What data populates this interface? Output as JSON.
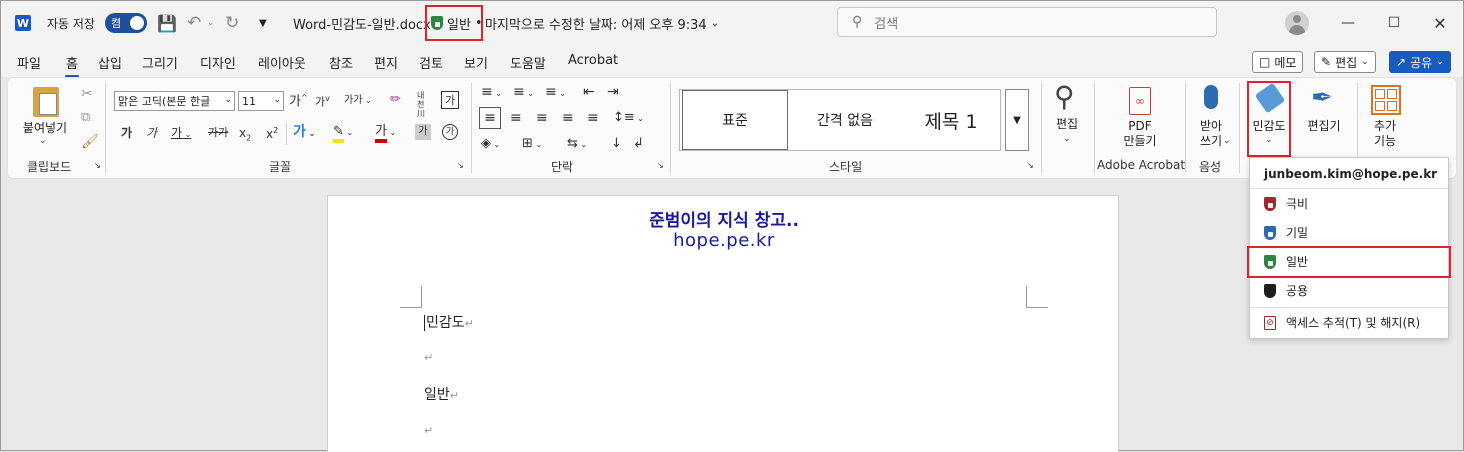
{
  "titlebar": {
    "word_logo": "W",
    "autosave_label": "자동 저장",
    "autosave_state": "켬",
    "filename": "Word-민감도-일반.docx",
    "sensitivity_label": "일반",
    "sensitivity_dot": "•",
    "last_modified": "마지막으로 수정한 날짜: 어제 오후 9:34",
    "search_placeholder": "검색"
  },
  "menu_tabs": [
    "파일",
    "홈",
    "삽입",
    "그리기",
    "디자인",
    "레이아웃",
    "참조",
    "편지",
    "검토",
    "보기",
    "도움말",
    "Acrobat"
  ],
  "active_tab": "홈",
  "top_buttons": {
    "memo": "메모",
    "edit": "편집",
    "share": "공유"
  },
  "ribbon": {
    "paste_label": "붙여넣기",
    "font_name": "맑은 고딕(본문 한글",
    "font_size": "11",
    "group_clipboard": "클립보드",
    "group_font": "글꼴",
    "group_paragraph": "단락",
    "group_styles": "스타일",
    "group_adobe": "Adobe Acrobat",
    "group_voice": "음성",
    "styles": [
      "표준",
      "간격 없음",
      "제목 1"
    ],
    "edit_label": "편집",
    "pdf_label_1": "PDF",
    "pdf_label_2": "만들기",
    "dictate_label_1": "받아",
    "dictate_label_2": "쓰기",
    "sensitivity_label": "민감도",
    "editor_label": "편집기",
    "addins_label_1": "추가",
    "addins_label_2": "기능",
    "font_glyphs": {
      "grow": "가",
      "shrink": "가",
      "case": "가가",
      "bold": "가",
      "italic": "가",
      "underline": "가",
      "strike": "가",
      "sub": "x",
      "sub2": "2",
      "sup": "x",
      "sup2": "2",
      "effects": "가",
      "highlight": "가",
      "color": "가",
      "shade": "가",
      "circle": "가"
    }
  },
  "document": {
    "watermark_line1": "준범이의 지식 창고..",
    "watermark_line2": "hope.pe.kr",
    "paragraphs": [
      "민감도",
      "",
      "일반",
      ""
    ]
  },
  "sensitivity_menu": {
    "account": "junbeom.kim@hope.pe.kr",
    "items": [
      {
        "label": "극비",
        "color": "#a4262c"
      },
      {
        "label": "기밀",
        "color": "#2b6cb0"
      },
      {
        "label": "일반",
        "color": "#2e8540"
      },
      {
        "label": "공용",
        "color": "#1f1f1f"
      }
    ],
    "access_label": "액세스 추적(T) 및 해지(R)"
  },
  "colors": {
    "accent": "#185abd",
    "highlight_box": "#d9262c",
    "watermark": "#1a1a9e"
  }
}
